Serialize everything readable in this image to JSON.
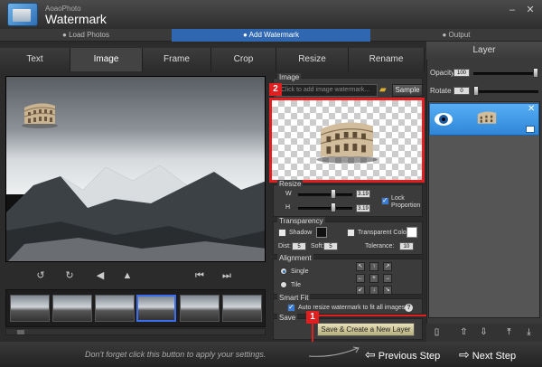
{
  "app": {
    "brand": "AoaoPhoto",
    "title": "Watermark"
  },
  "steps": [
    "Load Photos",
    "Add Watermark",
    "Output"
  ],
  "tabs": [
    "Text",
    "Image",
    "Frame",
    "Crop",
    "Resize",
    "Rename"
  ],
  "active_tab": "Image",
  "image_section": {
    "header": "Image",
    "placeholder": "Click to add image watermark...",
    "sample_label": "Sample"
  },
  "badges": {
    "one": "1",
    "two": "2"
  },
  "resize": {
    "header": "Resize",
    "w_label": "W",
    "h_label": "H",
    "w_value": "3.19",
    "h_value": "3.19",
    "lock_label": "Lock Proportion"
  },
  "transparency": {
    "header": "Transparency",
    "shadow_label": "Shadow",
    "transparent_color_label": "Transparent Color",
    "dist_label": "Dist:",
    "dist_value": "5",
    "soft_label": "Soft:",
    "soft_value": "5",
    "tolerance_label": "Tolerance:",
    "tolerance_value": "10"
  },
  "alignment": {
    "header": "Alignment",
    "single_label": "Single",
    "tile_label": "Tile"
  },
  "smart_fit": {
    "header": "Smart Fit",
    "auto_label": "Auto resize watermark to fit all images."
  },
  "save": {
    "header": "Save",
    "button_label": "Save & Create a New Layer"
  },
  "hint": "Don't forget click this button to apply your settings.",
  "nav": {
    "previous": "Previous Step",
    "next": "Next Step"
  },
  "layer": {
    "header": "Layer",
    "opacity_label": "Opacity",
    "opacity_value": "100",
    "rotate_label": "Rotate",
    "rotate_value": "0"
  },
  "colors": {
    "highlight": "#e02020",
    "selected_layer": "#3a8de0",
    "step_active": "#2f68b0"
  },
  "icons": [
    "rotate-left-icon",
    "rotate-right-icon",
    "flip-horizontal-icon",
    "flip-vertical-icon",
    "previous-image-icon",
    "next-image-icon",
    "folder-icon",
    "eye-icon",
    "close-icon",
    "help-icon"
  ]
}
